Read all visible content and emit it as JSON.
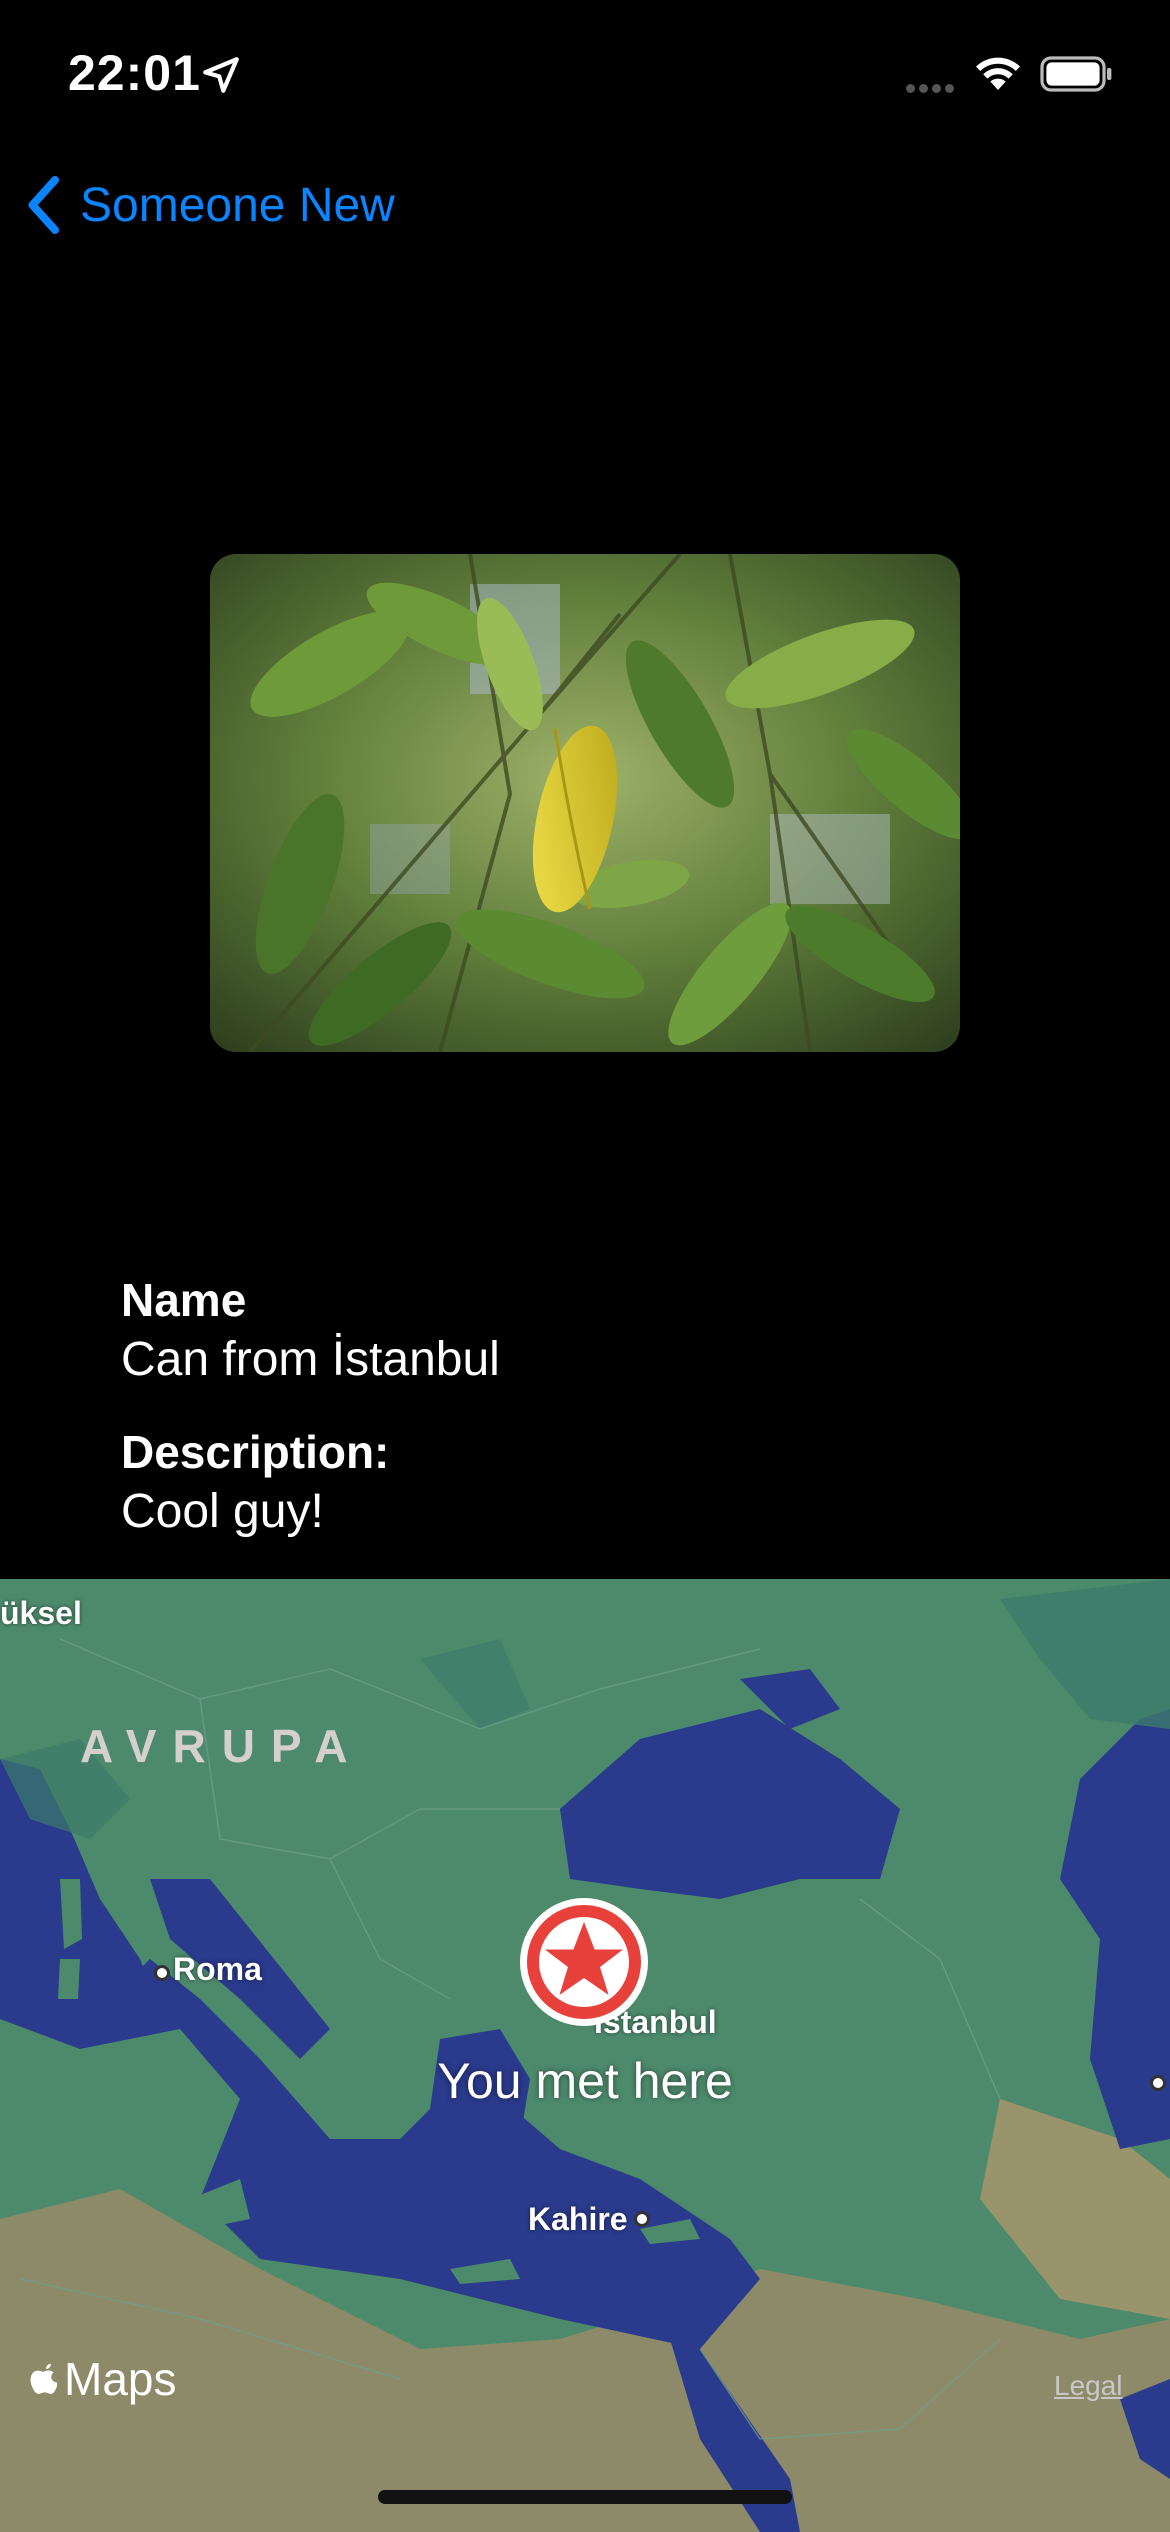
{
  "status_bar": {
    "time": "22:01"
  },
  "nav": {
    "back_label": "Someone New"
  },
  "person": {
    "name_label": "Name",
    "name_value": "Can from İstanbul",
    "description_label": "Description:",
    "description_value": "Cool guy!"
  },
  "map": {
    "region_label": "AVRUPA",
    "cities": {
      "partial": "üksel",
      "roma": "Roma",
      "istanbul": "İstanbul",
      "kahire": "Kahire"
    },
    "pin_label": "You met here",
    "maps_label": "Maps",
    "legal_label": "Legal"
  },
  "colors": {
    "accent": "#0a84ff",
    "sea": "#2a3a8c",
    "land": "#4d8a6c",
    "pin": "#e8413b"
  }
}
